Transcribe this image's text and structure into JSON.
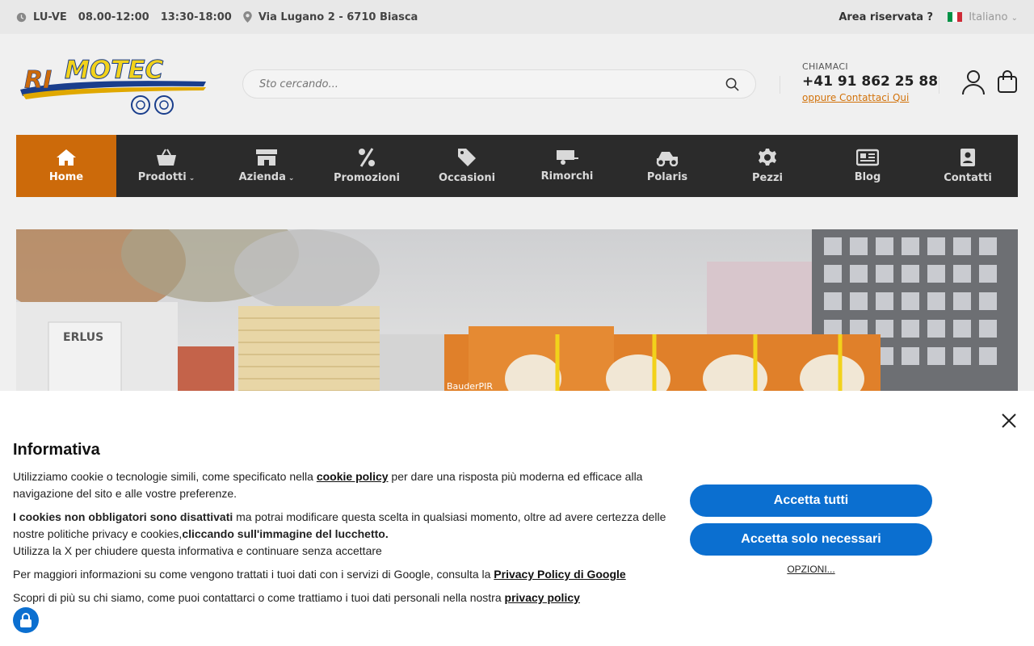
{
  "topbar": {
    "days": "LU-VE",
    "hours_morning": "08.00-12:00",
    "hours_afternoon": "13:30-18:00",
    "address": "Via Lugano 2 - 6710 Biasca",
    "reserved_area": "Area riservata ?",
    "language": "Italiano"
  },
  "header": {
    "logo_text": "RIMOTEC",
    "search_placeholder": "Sto cercando...",
    "call_label": "CHIAMACI",
    "phone": "+41 91 862 25 88",
    "contact_link": "oppure Contattaci Qui"
  },
  "nav": {
    "items": [
      {
        "label": "Home",
        "icon": "home-icon"
      },
      {
        "label": "Prodotti",
        "icon": "basket-icon"
      },
      {
        "label": "Azienda",
        "icon": "store-icon"
      },
      {
        "label": "Promozioni",
        "icon": "percent-icon"
      },
      {
        "label": "Occasioni",
        "icon": "tag-icon"
      },
      {
        "label": "Rimorchi",
        "icon": "trailer-icon"
      },
      {
        "label": "Polaris",
        "icon": "vehicle-icon"
      },
      {
        "label": "Pezzi",
        "icon": "gear-icon"
      },
      {
        "label": "Blog",
        "icon": "newspaper-icon"
      },
      {
        "label": "Contatti",
        "icon": "contact-book-icon"
      }
    ]
  },
  "hero": {
    "pallet_label": "ERLUS",
    "box_label": "BauderPIR"
  },
  "cookie": {
    "title": "Informativa",
    "p1_a": "Utilizziamo cookie o tecnologie simili, come specificato nella ",
    "p1_link": "cookie policy",
    "p1_b": " per dare una risposta più moderna ed efficace alla navigazione del sito e alle vostre preferenze.",
    "p2_bold": "I cookies non obbligatori sono disattivati",
    "p2_a": " ma potrai modificare questa scelta in qualsiasi momento, oltre ad avere certezza delle nostre politiche privacy e cookies,",
    "p2_bold2": "cliccando sull'immagine del lucchetto.",
    "p2_line": "Utilizza la X per chiudere questa informativa e continuare senza accettare",
    "p3_a": "Per maggiori informazioni su come vengono trattati i tuoi dati con i servizi di Google, consulta la ",
    "p3_link": "Privacy Policy di Google",
    "p4_a": "Scopri di più su chi siamo, come puoi contattarci o come trattiamo i tuoi dati personali nella nostra ",
    "p4_link": "privacy policy",
    "accept_all": "Accetta tutti",
    "accept_necessary": "Accetta solo necessari",
    "options": "OPZIONI..."
  },
  "colors": {
    "accent": "#cc6a0a",
    "nav_bg": "#2b2b2b",
    "button_blue": "#0b6fd0"
  }
}
